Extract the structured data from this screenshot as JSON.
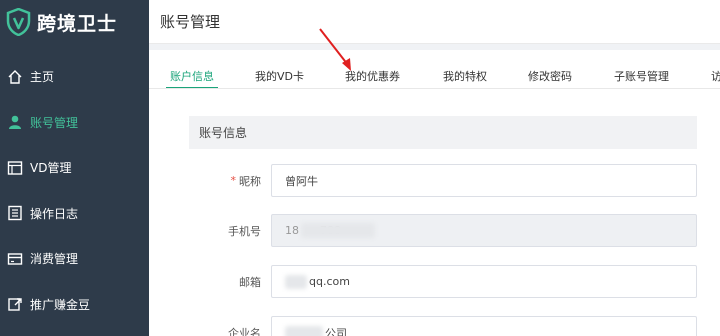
{
  "app": {
    "logo_text": "跨境卫士",
    "brand_color": "#1aa47a",
    "sidebar_bg": "#2e3b4a"
  },
  "sidebar": {
    "items": [
      {
        "label": "主页",
        "icon": "home-icon",
        "active": false
      },
      {
        "label": "账号管理",
        "icon": "user-icon",
        "active": true
      },
      {
        "label": "VD管理",
        "icon": "window-icon",
        "active": false
      },
      {
        "label": "操作日志",
        "icon": "log-icon",
        "active": false
      },
      {
        "label": "消费管理",
        "icon": "card-icon",
        "active": false
      },
      {
        "label": "推广赚金豆",
        "icon": "share-icon",
        "active": false
      }
    ]
  },
  "header": {
    "title": "账号管理"
  },
  "tabs": [
    {
      "label": "账户信息",
      "active": true
    },
    {
      "label": "我的VD卡",
      "active": false
    },
    {
      "label": "我的优惠券",
      "active": false
    },
    {
      "label": "我的特权",
      "active": false
    },
    {
      "label": "修改密码",
      "active": false
    },
    {
      "label": "子账号管理",
      "active": false
    },
    {
      "label": "访",
      "active": false
    }
  ],
  "section": {
    "title": "账号信息"
  },
  "form": {
    "nickname": {
      "label": "昵称",
      "required": true,
      "value": "曾阿牛"
    },
    "phone": {
      "label": "手机号",
      "value": "18      788",
      "disabled": true
    },
    "email": {
      "label": "邮箱",
      "value": "qq.com"
    },
    "company": {
      "label": "企业名",
      "value": "公司"
    }
  }
}
